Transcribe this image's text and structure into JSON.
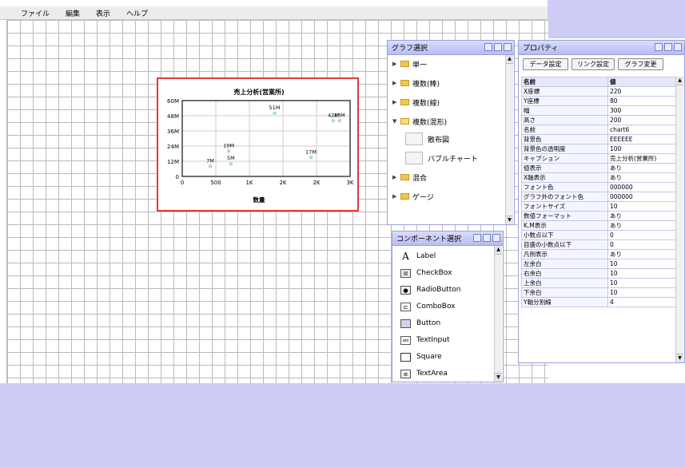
{
  "menu": [
    "ファイル",
    "編集",
    "表示",
    "ヘルプ"
  ],
  "chart_data": {
    "type": "scatter",
    "title": "売上分析(営業所)",
    "xlabel": "数量",
    "ylabel": "",
    "xlim": [
      0,
      3000
    ],
    "ylim": [
      0,
      60
    ],
    "xticks": [
      "0",
      "500",
      "1K",
      "2K",
      "2K",
      "3K"
    ],
    "yticks": [
      "0",
      "12M",
      "24M",
      "36M",
      "48M",
      "60M"
    ],
    "points": [
      {
        "x": 870,
        "y": 10,
        "label": "5M"
      },
      {
        "x": 1650,
        "y": 50,
        "label": "51M"
      },
      {
        "x": 2300,
        "y": 15,
        "label": "17M"
      },
      {
        "x": 2700,
        "y": 44,
        "label": "42M"
      },
      {
        "x": 2810,
        "y": 44,
        "label": "43M"
      },
      {
        "x": 830,
        "y": 20,
        "label": "19M"
      },
      {
        "x": 500,
        "y": 8,
        "label": "7M"
      }
    ]
  },
  "graph_panel": {
    "title": "グラフ選択",
    "items": [
      {
        "label": "単一",
        "arrow": "▶"
      },
      {
        "label": "複数(棒)",
        "arrow": "▶"
      },
      {
        "label": "複数(線)",
        "arrow": "▶"
      },
      {
        "label": "複数(混形)",
        "arrow": "▼"
      },
      {
        "label": "混合",
        "arrow": "▶"
      },
      {
        "label": "ゲージ",
        "arrow": "▶"
      }
    ],
    "subitems": [
      "散布図",
      "バブルチャート"
    ]
  },
  "component_panel": {
    "title": "コンポーネント選択",
    "items": [
      {
        "label": "Label",
        "icon": "label-icon"
      },
      {
        "label": "CheckBox",
        "icon": "checkbox-icon"
      },
      {
        "label": "RadioButton",
        "icon": "radio-button-icon"
      },
      {
        "label": "ComboBox",
        "icon": "combobox-icon"
      },
      {
        "label": "Button",
        "icon": "button-icon"
      },
      {
        "label": "TextInput",
        "icon": "text-input-icon"
      },
      {
        "label": "Square",
        "icon": "square-icon"
      },
      {
        "label": "TextArea",
        "icon": "text-area-icon"
      }
    ]
  },
  "property_panel": {
    "title": "プロパティ",
    "buttons": [
      "データ設定",
      "リンク設定",
      "グラフ変更"
    ],
    "headers": [
      "名前",
      "値"
    ],
    "rows": [
      [
        "X座標",
        "220"
      ],
      [
        "Y座標",
        "80"
      ],
      [
        "幅",
        "300"
      ],
      [
        "高さ",
        "200"
      ],
      [
        "名前",
        "chart6"
      ],
      [
        "背景色",
        "EEEEEE"
      ],
      [
        "背景色の透明度",
        "100"
      ],
      [
        "キャプション",
        "売上分析(営業所)"
      ],
      [
        "値表示",
        "あり"
      ],
      [
        "X軸表示",
        "あり"
      ],
      [
        "フォント色",
        "000000"
      ],
      [
        "グラフ外のフォント色",
        "000000"
      ],
      [
        "フォントサイズ",
        "10"
      ],
      [
        "数値フォーマット",
        "あり"
      ],
      [
        "K,M表示",
        "あり"
      ],
      [
        "小数点以下",
        "0"
      ],
      [
        "目盛の小数点以下",
        "0"
      ],
      [
        "凡例表示",
        "あり"
      ],
      [
        "左余白",
        "10"
      ],
      [
        "右余白",
        "10"
      ],
      [
        "上余白",
        "10"
      ],
      [
        "下余白",
        "10"
      ],
      [
        "Y軸分割線",
        "4"
      ]
    ]
  }
}
